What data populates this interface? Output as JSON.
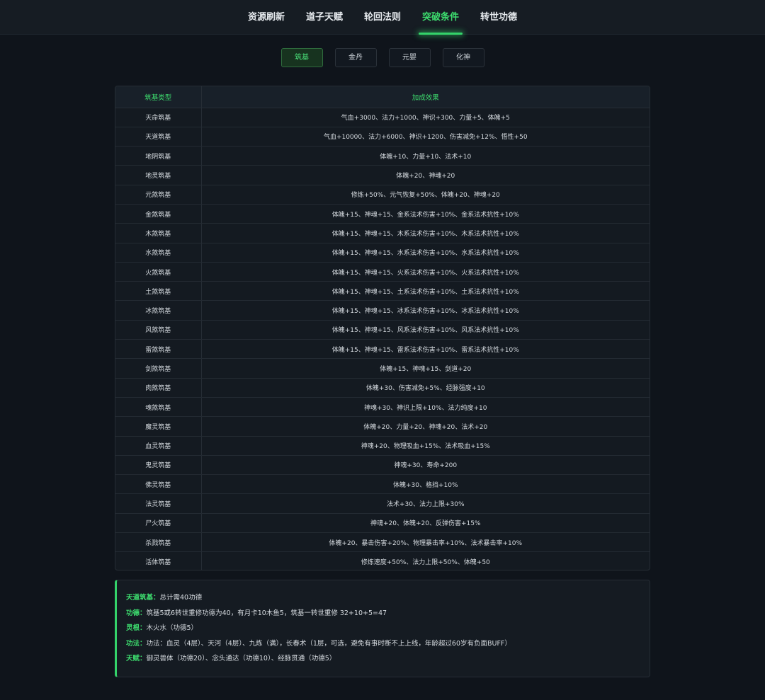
{
  "top_tabs": [
    "资源刷新",
    "道子天赋",
    "轮回法则",
    "突破条件",
    "转世功德"
  ],
  "sub_tabs": [
    "筑基",
    "金丹",
    "元婴",
    "化神"
  ],
  "table": {
    "headers": [
      "筑基类型",
      "加成效果"
    ],
    "rows": [
      [
        "天命筑基",
        "气血+3000、法力+1000、神识+300、力量+5、体魄+5"
      ],
      [
        "天道筑基",
        "气血+10000、法力+6000、神识+1200、伤害减免+12%、悟性+50"
      ],
      [
        "地阴筑基",
        "体魄+10、力量+10、法术+10"
      ],
      [
        "地灵筑基",
        "体魄+20、神魂+20"
      ],
      [
        "元煞筑基",
        "修炼+50%、元气恢复+50%、体魄+20、神魂+20"
      ],
      [
        "金煞筑基",
        "体魄+15、神魂+15、金系法术伤害+10%、金系法术抗性+10%"
      ],
      [
        "木煞筑基",
        "体魄+15、神魂+15、木系法术伤害+10%、木系法术抗性+10%"
      ],
      [
        "水煞筑基",
        "体魄+15、神魂+15、水系法术伤害+10%、水系法术抗性+10%"
      ],
      [
        "火煞筑基",
        "体魄+15、神魂+15、火系法术伤害+10%、火系法术抗性+10%"
      ],
      [
        "土煞筑基",
        "体魄+15、神魂+15、土系法术伤害+10%、土系法术抗性+10%"
      ],
      [
        "冰煞筑基",
        "体魄+15、神魂+15、冰系法术伤害+10%、冰系法术抗性+10%"
      ],
      [
        "风煞筑基",
        "体魄+15、神魂+15、风系法术伤害+10%、风系法术抗性+10%"
      ],
      [
        "雷煞筑基",
        "体魄+15、神魂+15、雷系法术伤害+10%、雷系法术抗性+10%"
      ],
      [
        "剑煞筑基",
        "体魄+15、神魂+15、剑道+20"
      ],
      [
        "肉煞筑基",
        "体魄+30、伤害减免+5%、经脉强度+10"
      ],
      [
        "魂煞筑基",
        "神魂+30、神识上限+10%、法力纯度+10"
      ],
      [
        "魔灵筑基",
        "体魄+20、力量+20、神魂+20、法术+20"
      ],
      [
        "血灵筑基",
        "神魂+20、物理吸血+15%、法术吸血+15%"
      ],
      [
        "鬼灵筑基",
        "神魂+30、寿命+200"
      ],
      [
        "佛灵筑基",
        "体魄+30、格挡+10%"
      ],
      [
        "法灵筑基",
        "法术+30、法力上限+30%"
      ],
      [
        "尸火筑基",
        "神魂+20、体魄+20、反弹伤害+15%"
      ],
      [
        "杀戮筑基",
        "体魄+20、暴击伤害+20%、物理暴击率+10%、法术暴击率+10%"
      ],
      [
        "活体筑基",
        "修炼速度+50%、法力上限+50%、体魄+50"
      ]
    ]
  },
  "notes": [
    {
      "key": "天道筑基：",
      "text": "总计需40功德"
    },
    {
      "key": "功德：",
      "text": "筑基5或6转世重修功德为40，有月卡10木鱼5，筑基一转世重修 32+10+5=47"
    },
    {
      "key": "灵根：",
      "text": "木火水（功德5）"
    },
    {
      "key": "功法：",
      "text": "功法：血灵（4层）、天河（4层）、九炼（满），长春术（1层，可选，避免有事时断不上上线，年龄超过60岁有负面BUFF）"
    },
    {
      "key": "天赋：",
      "text": "御灵兽体（功德20）、念头通达（功德10）、经脉贯通（功德5）"
    }
  ],
  "colors": {
    "accent": "#3ddc6e",
    "background": "#0f141b",
    "panel": "#141a21"
  }
}
